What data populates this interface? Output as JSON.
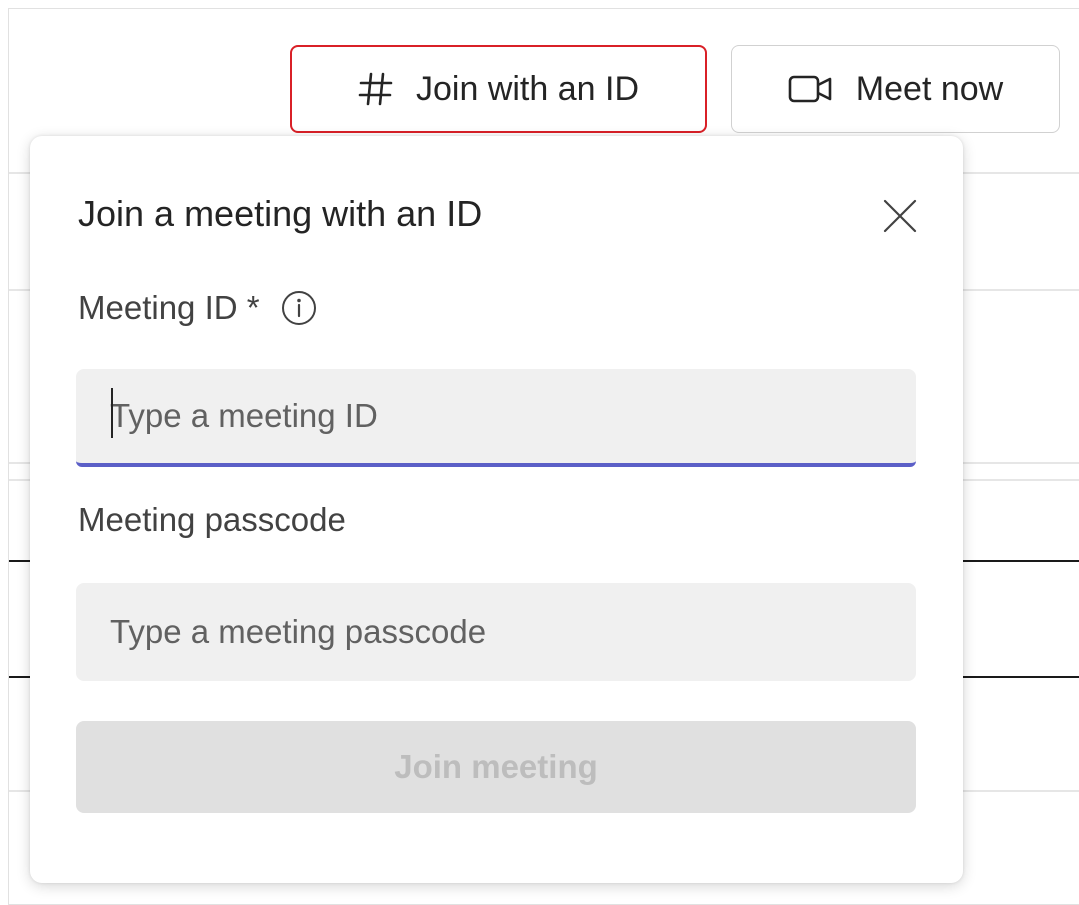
{
  "toolbar": {
    "join_with_id_label": "Join with an ID",
    "join_with_id_icon": "hash-icon",
    "meet_now_label": "Meet now",
    "meet_now_icon": "video-camera-icon",
    "focus_outline_color": "#d92027"
  },
  "dialog": {
    "title": "Join a meeting with an ID",
    "close_icon": "close-icon",
    "meeting_id": {
      "label": "Meeting ID *",
      "info_icon": "info-icon",
      "placeholder": "Type a meeting ID",
      "value": ""
    },
    "passcode": {
      "label": "Meeting passcode",
      "placeholder": "Type a meeting passcode",
      "value": ""
    },
    "join_button_label": "Join meeting",
    "join_button_enabled": false
  },
  "colors": {
    "accent": "#5b5fc7",
    "input_bg": "#f0f0f0",
    "disabled_bg": "#e0e0e0",
    "disabled_text": "#bdbdbd"
  }
}
